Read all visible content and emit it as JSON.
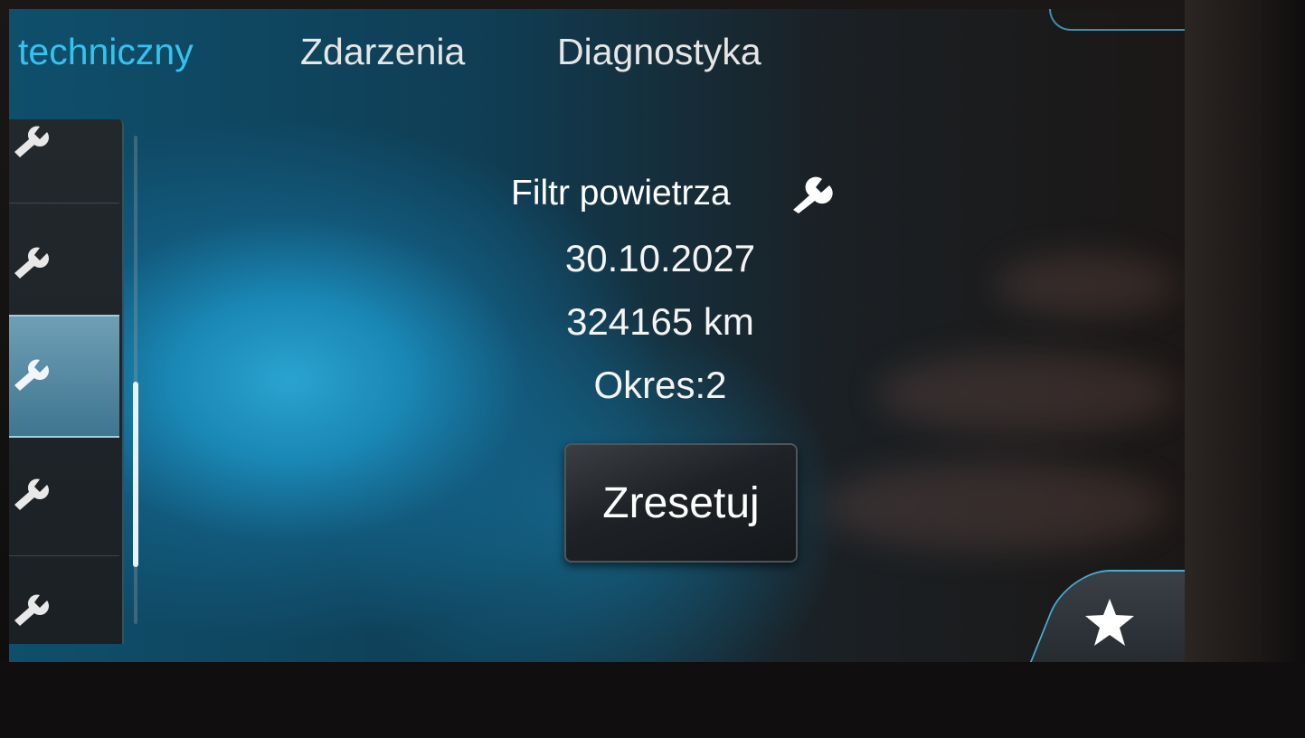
{
  "tabs": [
    {
      "label": "techniczny",
      "active": true
    },
    {
      "label": "Zdarzenia",
      "active": false
    },
    {
      "label": "Diagnostyka",
      "active": false
    }
  ],
  "sidebar": {
    "items": [
      {
        "icon": "wrench-icon",
        "selected": false
      },
      {
        "icon": "wrench-icon",
        "selected": false
      },
      {
        "icon": "wrench-icon",
        "selected": true
      },
      {
        "icon": "wrench-icon",
        "selected": false
      },
      {
        "icon": "wrench-icon",
        "selected": false
      }
    ]
  },
  "detail": {
    "title": "Filtr powietrza",
    "title_icon": "wrench-icon",
    "date": "30.10.2027",
    "distance": "324165 km",
    "period": "Okres:2",
    "reset_label": "Zresetuj"
  },
  "favorite": {
    "icon": "star-icon"
  },
  "colors": {
    "accent": "#33c3ee",
    "text": "#ffffff",
    "highlight": "#6e9fb6"
  }
}
